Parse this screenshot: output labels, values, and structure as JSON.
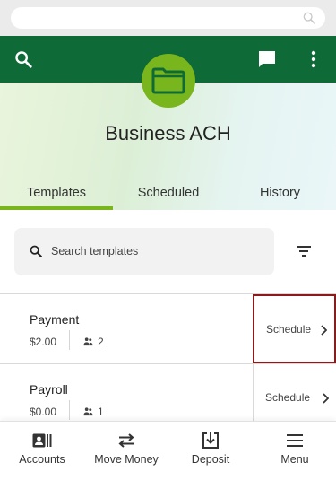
{
  "browser": {
    "url_value": ""
  },
  "app_bar": {
    "left_icon": "search-icon",
    "right_icons": [
      "chat-icon",
      "more-vert-icon"
    ]
  },
  "account": {
    "title": "Business ACH",
    "badge_icon": "folder-icon"
  },
  "tabs": [
    {
      "label": "Templates",
      "active": true
    },
    {
      "label": "Scheduled",
      "active": false
    },
    {
      "label": "History",
      "active": false
    }
  ],
  "search": {
    "placeholder": "Search templates"
  },
  "templates": [
    {
      "name": "Payment",
      "amount": "$2.00",
      "recipients": "2",
      "action": "Schedule"
    },
    {
      "name": "Payroll",
      "amount": "$0.00",
      "recipients": "1",
      "action": "Schedule"
    }
  ],
  "bottom_nav": [
    {
      "label": "Accounts",
      "icon": "accounts-icon"
    },
    {
      "label": "Move Money",
      "icon": "transfer-icon"
    },
    {
      "label": "Deposit",
      "icon": "deposit-icon"
    },
    {
      "label": "Menu",
      "icon": "menu-icon"
    }
  ],
  "colors": {
    "brand_green": "#0e6a36",
    "accent_green": "#79b51c",
    "highlight": "#8b1a1a"
  }
}
